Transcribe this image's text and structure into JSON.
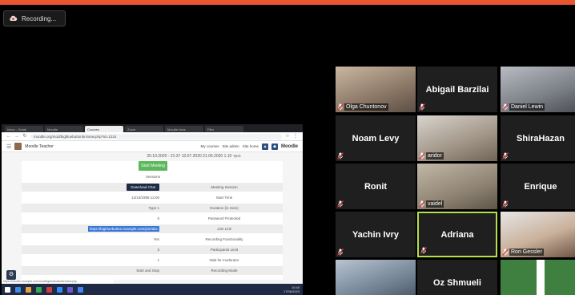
{
  "recording": {
    "label": "Recording..."
  },
  "share": {
    "tabs": [
      "Inbox - Gmail",
      "Moodle",
      "Courses",
      "Zoom",
      "Moodle docs",
      "Files"
    ],
    "url": "moodle.org/mod/bigbluebuttonbn/view.php?id=1234",
    "username": "Moodle Teacher",
    "menu_items": [
      "My courses",
      "Site admin",
      "Site home"
    ],
    "logo": "Moodle",
    "hebrew_line": "20.10.2020 - 21:37 בוקר 1.10 21.06.2020 10.07.2020",
    "start_button": "Start Meeting",
    "sessions_label": "Sessions",
    "download_button": "Download Chat",
    "rows": [
      {
        "value": "",
        "label": "Meeting Session"
      },
      {
        "value": "12/10/1999 12:00",
        "label": "Start Time"
      },
      {
        "value": "Type 1",
        "label": "Duration (in mins)"
      },
      {
        "value": "5",
        "label": "Password Protected"
      },
      {
        "value": "https://bigbluebutton.example.com/join/abc",
        "label": "Join Link"
      },
      {
        "value": "Yes",
        "label": "Recording Functionality"
      },
      {
        "value": "3",
        "label": "Participants Limit"
      },
      {
        "value": "1",
        "label": "Wait for moderator"
      },
      {
        "value": "Start and Stop",
        "label": "Recording Mode"
      }
    ],
    "status_url": "https://moodle.example.com/mod/bigbluebuttonbn/view.php",
    "clock_time": "10:45",
    "clock_date": "17/06/2020"
  },
  "participants": [
    {
      "name": "Olga Chuntonov",
      "video": true
    },
    {
      "name": "Abigail Barzilai",
      "video": false
    },
    {
      "name": "Daniel Lewin",
      "video": true
    },
    {
      "name": "Noam Levy",
      "video": false
    },
    {
      "name": "aridor",
      "video": true
    },
    {
      "name": "ShiraHazan",
      "video": false
    },
    {
      "name": "Ronit",
      "video": false
    },
    {
      "name": "vaidel",
      "video": true
    },
    {
      "name": "Enrique",
      "video": false
    },
    {
      "name": "Yachin Ivry",
      "video": false
    },
    {
      "name": "Adriana",
      "video": false,
      "active": true
    },
    {
      "name": "Ron Gessler",
      "video": true
    },
    {
      "name": "",
      "video": true
    },
    {
      "name": "Oz Shmueli",
      "video": false
    },
    {
      "name": "",
      "video": true
    }
  ],
  "colors": {
    "accent": "#e8552f",
    "active_speaker": "#b5e04a",
    "mic_muted": "#e53935"
  }
}
